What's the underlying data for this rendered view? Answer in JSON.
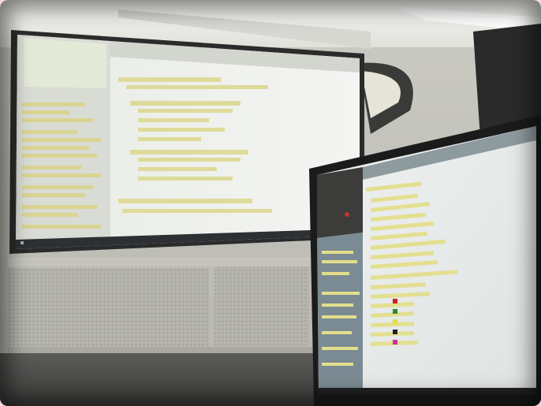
{
  "scene": {
    "description_label": "",
    "projector_heading": "",
    "monitor_heading": "",
    "monitor_panel_label": ""
  },
  "colors": {
    "frame_border": "#f6d9dc",
    "wall": "#cfcfc8",
    "ceiling": "#f2f2ee",
    "screen_bg": "#eef0ef",
    "code_block": "#e0dc95",
    "monitor_bezel": "#1b1b1b",
    "monitor_screen": "#e9eceb",
    "monitor_sidebar": "#7b8b93"
  },
  "icons": [
    "windows-taskbar-icon",
    "palette-icon"
  ]
}
